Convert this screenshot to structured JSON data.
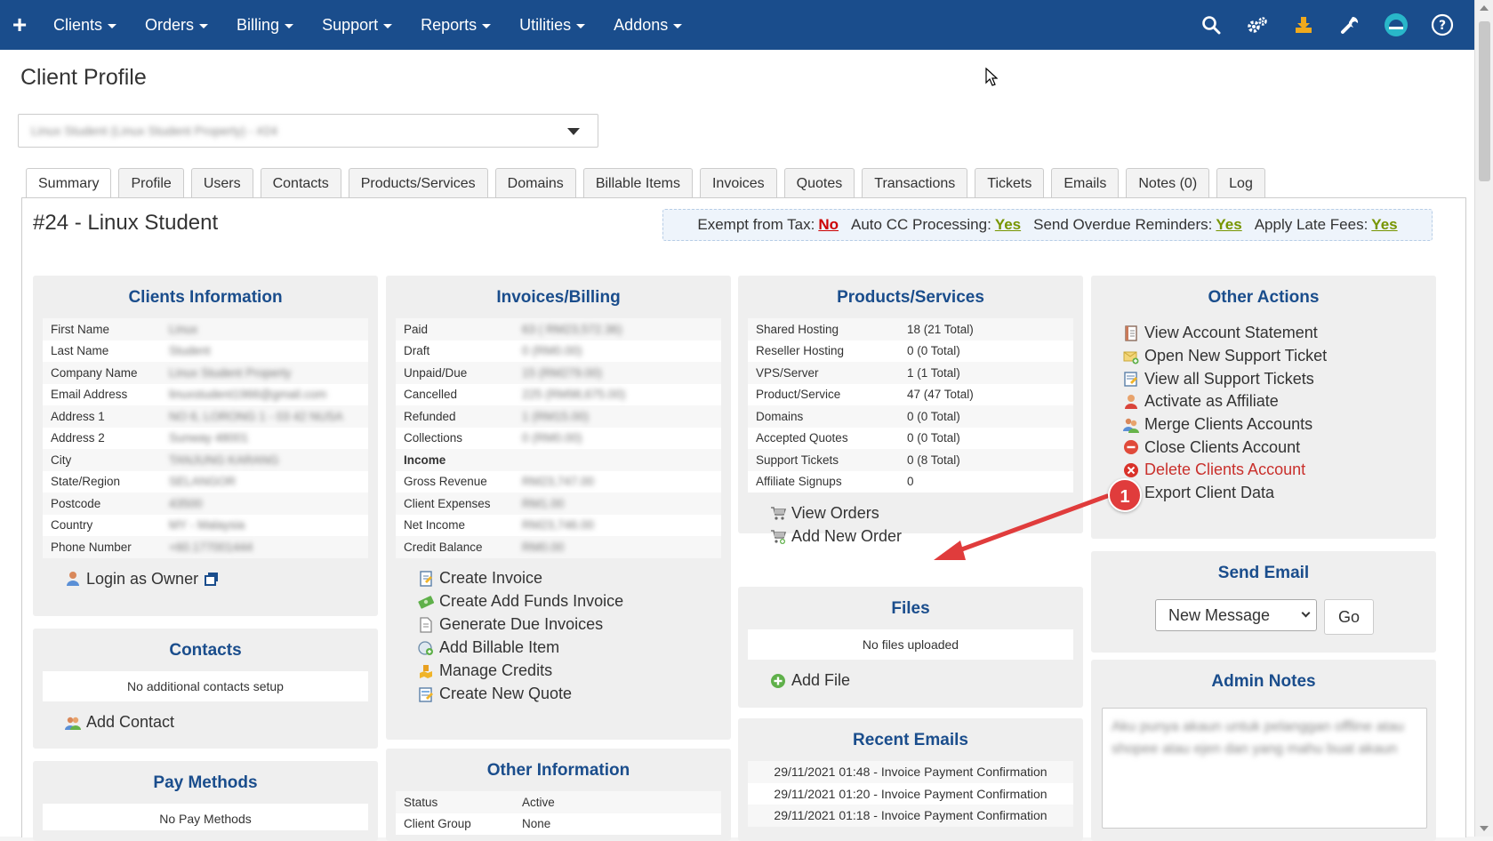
{
  "nav": {
    "menu": [
      "Clients",
      "Orders",
      "Billing",
      "Support",
      "Reports",
      "Utilities",
      "Addons"
    ]
  },
  "page_title": "Client Profile",
  "client_select_value": "Linux Student (Linux Student Property) - #24",
  "tabs": [
    "Summary",
    "Profile",
    "Users",
    "Contacts",
    "Products/Services",
    "Domains",
    "Billable Items",
    "Invoices",
    "Quotes",
    "Transactions",
    "Tickets",
    "Emails",
    "Notes (0)",
    "Log"
  ],
  "client_heading": "#24 - Linux Student",
  "tax_bar": [
    {
      "label": "Exempt from Tax:",
      "value": "No"
    },
    {
      "label": "Auto CC Processing:",
      "value": "Yes"
    },
    {
      "label": "Send Overdue Reminders:",
      "value": "Yes"
    },
    {
      "label": "Apply Late Fees:",
      "value": "Yes"
    }
  ],
  "clients_info": {
    "title": "Clients Information",
    "rows": [
      {
        "k": "First Name",
        "v": "Linux"
      },
      {
        "k": "Last Name",
        "v": "Student"
      },
      {
        "k": "Company Name",
        "v": "Linux Student Property"
      },
      {
        "k": "Email Address",
        "v": "linuxstudent1966@gmail.com"
      },
      {
        "k": "Address 1",
        "v": "NO 6, LORONG 1 - 03 42 NUSA"
      },
      {
        "k": "Address 2",
        "v": "Sunway 48001"
      },
      {
        "k": "City",
        "v": "TANJUNG KARANG"
      },
      {
        "k": "State/Region",
        "v": "SELANGOR"
      },
      {
        "k": "Postcode",
        "v": "43500"
      },
      {
        "k": "Country",
        "v": "MY - Malaysia"
      },
      {
        "k": "Phone Number",
        "v": "+60.177001444"
      }
    ],
    "login_link": "Login as Owner"
  },
  "contacts": {
    "title": "Contacts",
    "empty": "No additional contacts setup",
    "add_link": "Add Contact"
  },
  "pay_methods": {
    "title": "Pay Methods",
    "empty": "No Pay Methods"
  },
  "invoices_billing": {
    "title": "Invoices/Billing",
    "rows": [
      {
        "k": "Paid",
        "v": "63 ( RM23,572.36)",
        "bold": false
      },
      {
        "k": "Draft",
        "v": "0 (RM0.00)",
        "bold": false
      },
      {
        "k": "Unpaid/Due",
        "v": "15 (RM279.00)",
        "bold": false
      },
      {
        "k": "Cancelled",
        "v": "225 (RM98,675.00)",
        "bold": false
      },
      {
        "k": "Refunded",
        "v": "1 (RM15.00)",
        "bold": false
      },
      {
        "k": "Collections",
        "v": "0 (RM0.00)",
        "bold": false
      },
      {
        "k": "Income",
        "v": "",
        "bold": true
      },
      {
        "k": "Gross Revenue",
        "v": "RM23,747.00",
        "bold": false
      },
      {
        "k": "Client Expenses",
        "v": "RM1.00",
        "bold": false
      },
      {
        "k": "Net Income",
        "v": "RM23,746.00",
        "bold": false
      },
      {
        "k": "Credit Balance",
        "v": "RM0.00",
        "bold": false
      }
    ],
    "links": [
      "Create Invoice",
      "Create Add Funds Invoice",
      "Generate Due Invoices",
      "Add Billable Item",
      "Manage Credits",
      "Create New Quote"
    ]
  },
  "other_info": {
    "title": "Other Information",
    "rows": [
      {
        "k": "Status",
        "v": "Active"
      },
      {
        "k": "Client Group",
        "v": "None"
      }
    ]
  },
  "products_services": {
    "title": "Products/Services",
    "rows": [
      {
        "k": "Shared Hosting",
        "v": "18 (21 Total)"
      },
      {
        "k": "Reseller Hosting",
        "v": "0 (0 Total)"
      },
      {
        "k": "VPS/Server",
        "v": "1 (1 Total)"
      },
      {
        "k": "Product/Service",
        "v": "47 (47 Total)"
      },
      {
        "k": "Domains",
        "v": "0 (0 Total)"
      },
      {
        "k": "Accepted Quotes",
        "v": "0 (0 Total)"
      },
      {
        "k": "Support Tickets",
        "v": "0 (8 Total)"
      },
      {
        "k": "Affiliate Signups",
        "v": "0"
      }
    ],
    "links": [
      "View Orders",
      "Add New Order"
    ]
  },
  "files": {
    "title": "Files",
    "empty": "No files uploaded",
    "add_link": "Add File"
  },
  "recent_emails": {
    "title": "Recent Emails",
    "rows": [
      "29/11/2021 01:48 - Invoice Payment Confirmation",
      "29/11/2021 01:20 - Invoice Payment Confirmation",
      "29/11/2021 01:18 - Invoice Payment Confirmation"
    ]
  },
  "other_actions": {
    "title": "Other Actions",
    "links": [
      {
        "label": "View Account Statement",
        "red": false
      },
      {
        "label": "Open New Support Ticket",
        "red": false
      },
      {
        "label": "View all Support Tickets",
        "red": false
      },
      {
        "label": "Activate as Affiliate",
        "red": false
      },
      {
        "label": "Merge Clients Accounts",
        "red": false
      },
      {
        "label": "Close Clients Account",
        "red": false
      },
      {
        "label": "Delete Clients Account",
        "red": true
      },
      {
        "label": "Export Client Data",
        "red": false
      }
    ]
  },
  "send_email": {
    "title": "Send Email",
    "selected": "New Message",
    "go": "Go"
  },
  "admin_notes": {
    "title": "Admin Notes",
    "text": "Aku punya akaun untuk pelanggan offline atau shopee atau ejen dan yang mahu buat akaun"
  },
  "callout_number": "1",
  "colors": {
    "nav_bg": "#1a4d8c",
    "panel_title": "#1a4d8c",
    "red_link": "#c9302c",
    "yes_green": "#779500",
    "no_red": "#cc0000",
    "callout": "#e03c3c"
  },
  "icons": {
    "nav_right": [
      "search-icon",
      "gears-icon",
      "download-icon",
      "wrench-icon",
      "avatar-icon",
      "help-icon"
    ]
  }
}
